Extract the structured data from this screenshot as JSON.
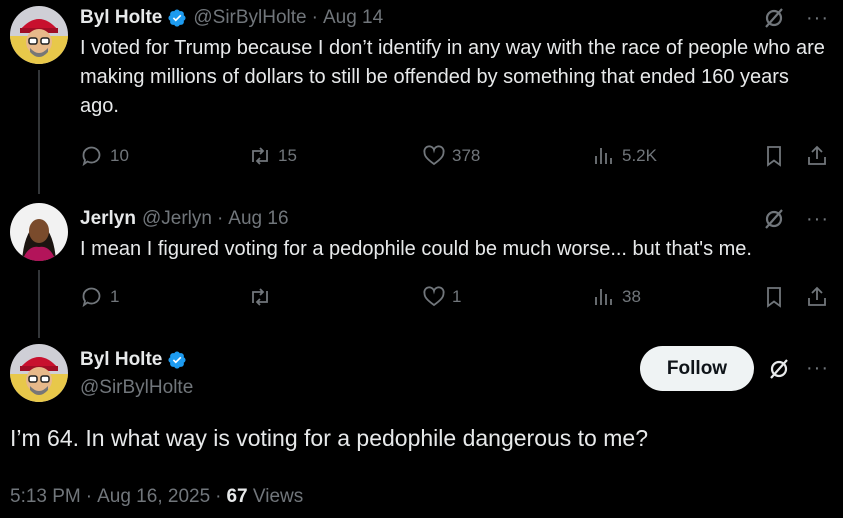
{
  "tweets": [
    {
      "name": "Byl Holte",
      "handle": "@SirBylHolte",
      "date": "Aug 14",
      "text": "I voted for Trump because I don’t identify in any way with the race of people who are making millions of dollars to still be offended by something that ended 160 years ago.",
      "replies": "10",
      "reposts": "15",
      "likes": "378",
      "views": "5.2K"
    },
    {
      "name": "Jerlyn",
      "handle": "@Jerlyn",
      "date": "Aug 16",
      "text": "I mean I figured voting for a pedophile could be much worse... but that's me.",
      "replies": "1",
      "reposts": "",
      "likes": "1",
      "views": "38"
    }
  ],
  "main": {
    "name": "Byl Holte",
    "handle": "@SirBylHolte",
    "follow_label": "Follow",
    "text": "I’m 64. In what way is voting for a pedophile dangerous to me?",
    "time": "5:13 PM",
    "date": "Aug 16, 2025",
    "views_count": "67",
    "views_label": "Views"
  },
  "icons": {
    "verified": "verified-badge-icon",
    "grok": "grok-icon",
    "more": "more-icon",
    "reply": "reply-icon",
    "repost": "repost-icon",
    "like": "like-icon",
    "views": "views-icon",
    "bookmark": "bookmark-icon",
    "share": "share-icon"
  },
  "colors": {
    "background": "#000000",
    "text": "#e7e9ea",
    "muted": "#71767b",
    "verified": "#1d9bf0",
    "follow_bg": "#eff3f4"
  }
}
